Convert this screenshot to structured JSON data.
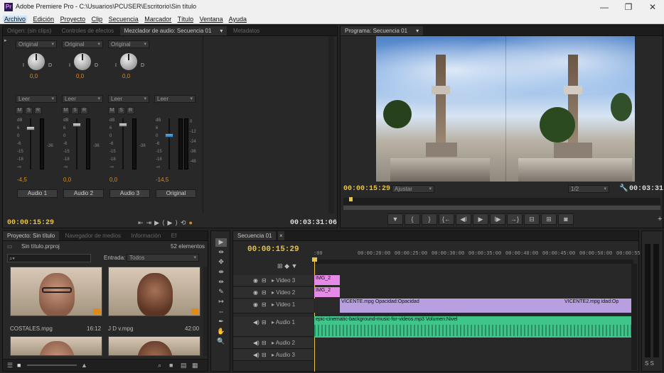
{
  "window": {
    "title": "Adobe Premiere Pro - C:\\Usuarios\\PCUSER\\Escritorio\\Sin título",
    "app_icon": "Pr"
  },
  "menu": [
    "Archivo",
    "Edición",
    "Proyecto",
    "Clip",
    "Secuencia",
    "Marcador",
    "Título",
    "Ventana",
    "Ayuda"
  ],
  "source_panel": {
    "tabs": [
      "Origen: (sin clips)",
      "Controles de efectos",
      "Mezclador de audio: Secuencia 01",
      "Metadatos"
    ],
    "active_tab_index": 2
  },
  "mixer": {
    "channels": [
      {
        "mode": "Original",
        "pan": "0,0",
        "automation": "Leer",
        "level": "-4,5",
        "label": "Audio 1",
        "fader_db": -4.5
      },
      {
        "mode": "Original",
        "pan": "0,0",
        "automation": "Leer",
        "level": "0,0",
        "label": "Audio 2",
        "fader_db": 0
      },
      {
        "mode": "Original",
        "pan": "0,0",
        "automation": "Leer",
        "level": "0,0",
        "label": "Audio 3",
        "fader_db": 0
      },
      {
        "mode": "",
        "pan": "",
        "automation": "Leer",
        "level": "-14,5",
        "label": "Original",
        "fader_db": -14.5
      }
    ],
    "msr": [
      "M",
      "S",
      "R"
    ],
    "db_scale": [
      "dB",
      "6",
      "0",
      "-6",
      "-15",
      "-18",
      "-∞"
    ],
    "master_scale": [
      "0",
      "-12",
      "-24",
      "-36",
      "-48"
    ],
    "timecode_left": "00:00:15:29",
    "timecode_right": "00:03:31:06",
    "transport_icons": [
      "⇤",
      "⇥",
      "▶",
      "⟨▶⟩",
      "⟲",
      "●"
    ]
  },
  "program_panel": {
    "tab": "Programa: Secuencia 01",
    "timecode": "00:00:15:29",
    "fit": "Ajustar",
    "resolution": "1/2",
    "duration": "00:03:31:0",
    "controls": [
      "▼",
      "{",
      "}",
      "{←",
      "◀I",
      "▶",
      "I▶",
      "→}",
      "⊟",
      "⊞",
      "◙"
    ]
  },
  "project_panel": {
    "tabs": [
      "Proyecto: Sin título",
      "Navegador de medios",
      "Información",
      "Ef"
    ],
    "file": "Sin título.prproj",
    "count": "52 elementos",
    "search_placeholder": "",
    "entrada_label": "Entrada:",
    "entrada_value": "Todos",
    "items": [
      {
        "name": "COSTALES.mpg",
        "duration": "16:12"
      },
      {
        "name": "J D v.mpg",
        "duration": "42:00"
      }
    ]
  },
  "tools": [
    "▶",
    "⇹",
    "✥",
    "⇼",
    "⇹",
    "✎",
    "↦",
    "⇔",
    "✒",
    "✋",
    "🔍"
  ],
  "timeline": {
    "tab": "Secuencia 01",
    "timecode": "00:00:15:29",
    "ruler": [
      ":00",
      "00:00:20:00",
      "00:00:25:00",
      "00:00:30:00",
      "00:00:35:00",
      "00:00:40:00",
      "00:00:45:00",
      "00:00:50:00",
      "00:00:55:00"
    ],
    "tracks": [
      {
        "name": "Video 3"
      },
      {
        "name": "Video 2"
      },
      {
        "name": "Video 1"
      },
      {
        "name": "Audio 1"
      },
      {
        "name": "Audio 2"
      },
      {
        "name": "Audio 3"
      }
    ],
    "clips": {
      "v3": "IMG_2",
      "v2": "IMG_2",
      "v1a": "VICENTE.mpg Opacidad:Opacidad",
      "v1b": "VICENTE2.mpg idad:Op",
      "a1": "epic-cinematic-background-music-for-videos.mp3 Volumen:Nivel"
    }
  },
  "colors": {
    "accent_timecode": "#e8c441",
    "blue_label": "#4aa2f5",
    "video_clip": "#b8a0e0",
    "audio_clip": "#3fc48a",
    "image_clip": "#e68ae8"
  }
}
